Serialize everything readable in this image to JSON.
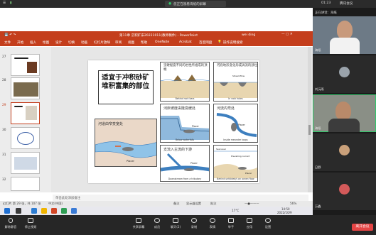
{
  "meeting": {
    "sharing_label": "您正在观看海纸的屏幕",
    "time": "01:23",
    "recording_label": "腾讯会议",
    "speaker_label": "正在讲话：海纸"
  },
  "ppt": {
    "title": "第11章 沉积矿床20221011(教师稿件) - PowerPoint",
    "user": "wei ding",
    "ribbon": [
      "文件",
      "开始",
      "插入",
      "绘图",
      "设计",
      "切换",
      "动画",
      "幻灯片放映",
      "审阅",
      "视图",
      "帮助",
      "OneNote",
      "Acrobat",
      "百度网盘",
      "操作说明搜索"
    ],
    "thumb_numbers": [
      "27",
      "28",
      "29",
      "30",
      "31",
      "32"
    ],
    "notes_placeholder": "单击此处添加备注",
    "status_left": "幻灯片 第 29 张，共 107 张",
    "status_lang": "中文(中国)",
    "status_right": [
      "备注",
      "显示器设置",
      "批注"
    ],
    "zoom": "56%",
    "taskbar_time": "14:50",
    "taskbar_date": "2022/10/9",
    "temp": "17°C"
  },
  "slide": {
    "title": "适宜于冲积砂矿堆积富集的部位",
    "panels": {
      "curve": {
        "title": "河道由窄变宽处",
        "placer": "Placer"
      },
      "rock_bars": {
        "title": "坚硬程度不同的岩性所组成的顶端",
        "caption": "Behind rock bars"
      },
      "rock_holes": {
        "title": "河底地形变化形成涡流的部位",
        "caption": "In rock holes",
        "sub": "Streamflow"
      },
      "waterfall": {
        "title": "河床坡度由陡变缓处",
        "caption": "Below waterfalls",
        "sub": "Placer"
      },
      "meander": {
        "title": "河流内弯处",
        "caption": "Inside meander loops",
        "sub": "Placer"
      },
      "tributary": {
        "title": "支流入主流的下游",
        "caption": "Downstream from a tributary",
        "sub": "Placer"
      },
      "ocean": {
        "title": "",
        "caption": "Behind unfolded/s on ocean floor",
        "sub": "Prevailing current",
        "sub2": "Sea level",
        "sub3": "Placer"
      }
    }
  },
  "participants": [
    {
      "name": "海纸",
      "type": "video"
    },
    {
      "name": "刘沅雨",
      "type": "avatar"
    },
    {
      "name": "海纸",
      "type": "video"
    },
    {
      "name": "日野",
      "type": "avatar"
    },
    {
      "name": "万鑫",
      "type": "avatar"
    }
  ],
  "leave_label": "离开会议",
  "bottom_tools_left": [
    {
      "label": "解除静音",
      "icon": "mic-icon"
    },
    {
      "label": "停止视频",
      "icon": "camera-icon"
    }
  ],
  "bottom_tools_right": [
    {
      "label": "共享屏幕",
      "icon": "share-icon"
    },
    {
      "label": "成员",
      "icon": "members-icon"
    },
    {
      "label": "聊天(2)",
      "icon": "chat-icon"
    },
    {
      "label": "录制",
      "icon": "record-icon"
    },
    {
      "label": "表情",
      "icon": "emoji-icon"
    },
    {
      "label": "举手",
      "icon": "hand-icon"
    },
    {
      "label": "应用",
      "icon": "apps-icon"
    },
    {
      "label": "设置",
      "icon": "settings-icon"
    }
  ]
}
